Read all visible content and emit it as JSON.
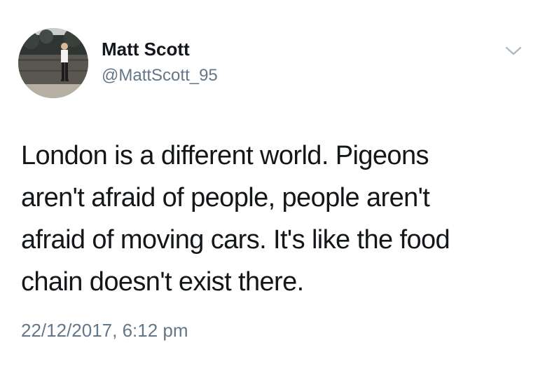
{
  "tweet": {
    "display_name": "Matt Scott",
    "handle": "@MattScott_95",
    "text": "London is a different world. Pigeons\naren't afraid of people, people aren't\nafraid of moving cars. It's like the food\nchain doesn't exist there.",
    "timestamp": "22/12/2017, 6:12 pm",
    "menu_icon": "chevron-down-icon"
  },
  "colors": {
    "text": "#14171a",
    "secondary_text": "#657786",
    "caret": "#aab8c2",
    "background": "#ffffff"
  }
}
